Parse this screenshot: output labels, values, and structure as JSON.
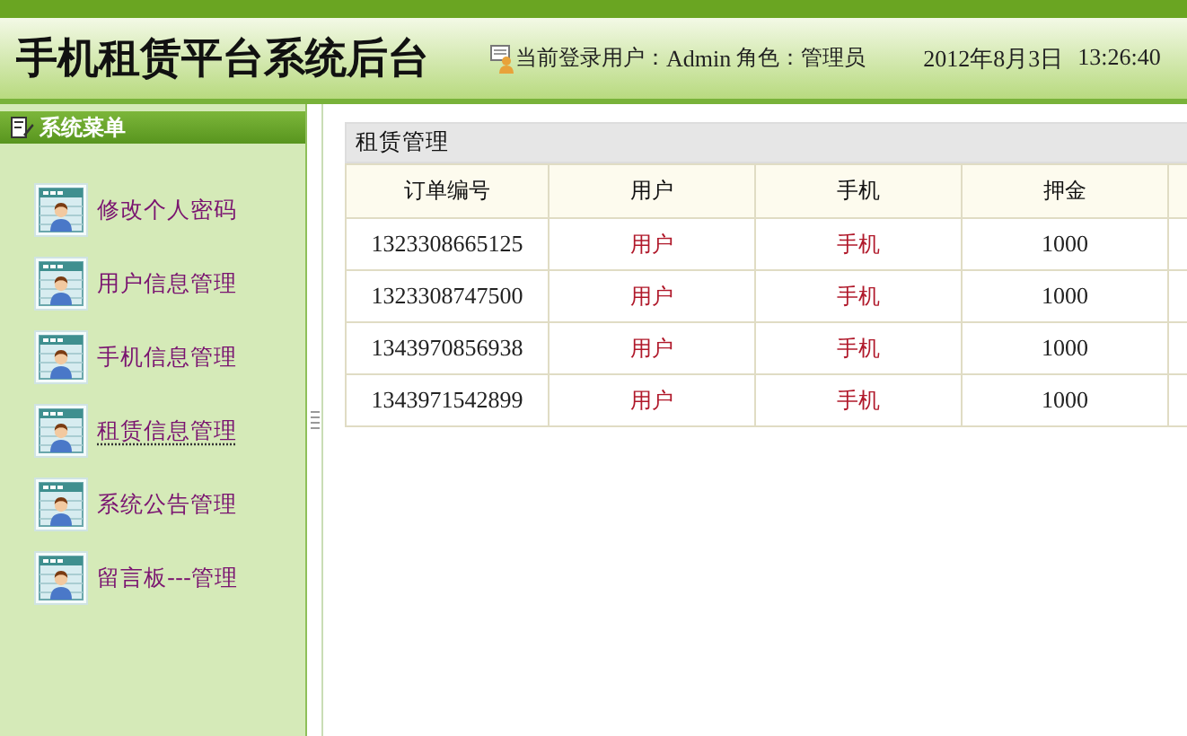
{
  "header": {
    "title": "手机租赁平台系统后台",
    "login_label": "当前登录用户：",
    "user": "Admin",
    "role_label": "角色：",
    "role": "管理员",
    "date": "2012年8月3日",
    "time": "13:26:40"
  },
  "sidebar": {
    "title": "系统菜单",
    "items": [
      {
        "label": "修改个人密码",
        "selected": false
      },
      {
        "label": "用户信息管理",
        "selected": false
      },
      {
        "label": "手机信息管理",
        "selected": false
      },
      {
        "label": "租赁信息管理",
        "selected": true
      },
      {
        "label": "系统公告管理",
        "selected": false
      },
      {
        "label": "留言板---管理",
        "selected": false
      }
    ]
  },
  "panel": {
    "title": "租赁管理",
    "columns": [
      "订单编号",
      "用户",
      "手机",
      "押金"
    ],
    "rows": [
      {
        "order": "1323308665125",
        "user": "用户",
        "phone": "手机",
        "deposit": "1000"
      },
      {
        "order": "1323308747500",
        "user": "用户",
        "phone": "手机",
        "deposit": "1000"
      },
      {
        "order": "1343970856938",
        "user": "用户",
        "phone": "手机",
        "deposit": "1000"
      },
      {
        "order": "1343971542899",
        "user": "用户",
        "phone": "手机",
        "deposit": "1000"
      }
    ]
  }
}
